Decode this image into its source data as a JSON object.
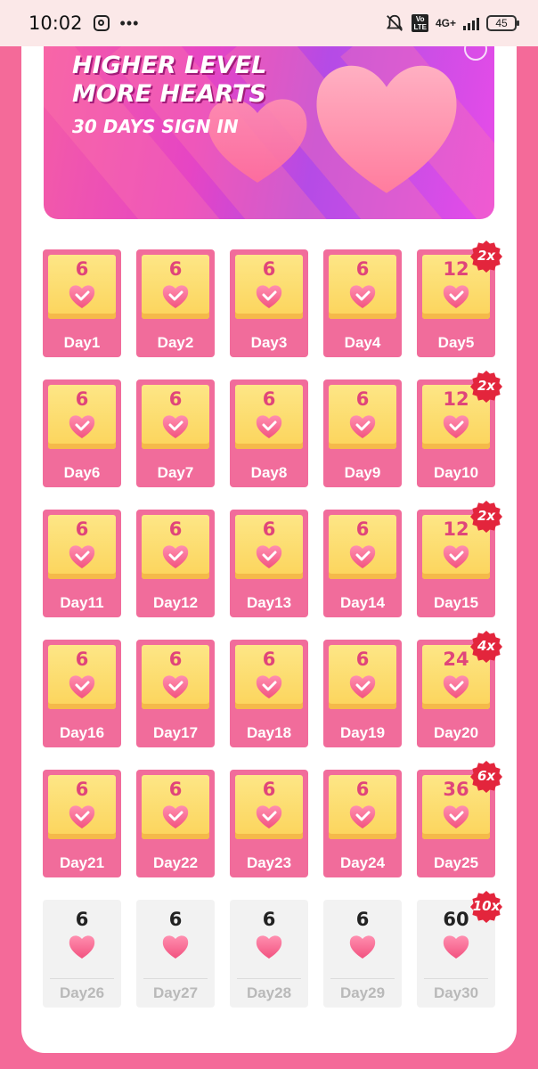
{
  "status_bar": {
    "time": "10:02",
    "network": "4G+",
    "volte": "Vo\nLTE",
    "battery": "45",
    "icons": [
      "instagram-icon",
      "more-dots-icon",
      "mute-icon",
      "volte-icon",
      "signal-icon",
      "battery-icon"
    ]
  },
  "banner": {
    "title_line1": "HIGHER LEVEL",
    "title_line2": "MORE HEARTS",
    "subtitle": "30 DAYS SIGN IN"
  },
  "colors": {
    "frame": "#f46a99",
    "tile_claimed": "#f16c9b",
    "tile_future": "#f2f2f2",
    "badge": "#e3253c",
    "amount_text": "#e0457a"
  },
  "days": [
    {
      "label": "Day1",
      "amount": "6",
      "status": "claimed",
      "badge": ""
    },
    {
      "label": "Day2",
      "amount": "6",
      "status": "claimed",
      "badge": ""
    },
    {
      "label": "Day3",
      "amount": "6",
      "status": "claimed",
      "badge": ""
    },
    {
      "label": "Day4",
      "amount": "6",
      "status": "claimed",
      "badge": ""
    },
    {
      "label": "Day5",
      "amount": "12",
      "status": "claimed",
      "badge": "2x"
    },
    {
      "label": "Day6",
      "amount": "6",
      "status": "claimed",
      "badge": ""
    },
    {
      "label": "Day7",
      "amount": "6",
      "status": "claimed",
      "badge": ""
    },
    {
      "label": "Day8",
      "amount": "6",
      "status": "claimed",
      "badge": ""
    },
    {
      "label": "Day9",
      "amount": "6",
      "status": "claimed",
      "badge": ""
    },
    {
      "label": "Day10",
      "amount": "12",
      "status": "claimed",
      "badge": "2x"
    },
    {
      "label": "Day11",
      "amount": "6",
      "status": "claimed",
      "badge": ""
    },
    {
      "label": "Day12",
      "amount": "6",
      "status": "claimed",
      "badge": ""
    },
    {
      "label": "Day13",
      "amount": "6",
      "status": "claimed",
      "badge": ""
    },
    {
      "label": "Day14",
      "amount": "6",
      "status": "claimed",
      "badge": ""
    },
    {
      "label": "Day15",
      "amount": "12",
      "status": "claimed",
      "badge": "2x"
    },
    {
      "label": "Day16",
      "amount": "6",
      "status": "claimed",
      "badge": ""
    },
    {
      "label": "Day17",
      "amount": "6",
      "status": "claimed",
      "badge": ""
    },
    {
      "label": "Day18",
      "amount": "6",
      "status": "claimed",
      "badge": ""
    },
    {
      "label": "Day19",
      "amount": "6",
      "status": "claimed",
      "badge": ""
    },
    {
      "label": "Day20",
      "amount": "24",
      "status": "claimed",
      "badge": "4x"
    },
    {
      "label": "Day21",
      "amount": "6",
      "status": "claimed",
      "badge": ""
    },
    {
      "label": "Day22",
      "amount": "6",
      "status": "claimed",
      "badge": ""
    },
    {
      "label": "Day23",
      "amount": "6",
      "status": "claimed",
      "badge": ""
    },
    {
      "label": "Day24",
      "amount": "6",
      "status": "claimed",
      "badge": ""
    },
    {
      "label": "Day25",
      "amount": "36",
      "status": "claimed",
      "badge": "6x"
    },
    {
      "label": "Day26",
      "amount": "6",
      "status": "future",
      "badge": ""
    },
    {
      "label": "Day27",
      "amount": "6",
      "status": "future",
      "badge": ""
    },
    {
      "label": "Day28",
      "amount": "6",
      "status": "future",
      "badge": ""
    },
    {
      "label": "Day29",
      "amount": "6",
      "status": "future",
      "badge": ""
    },
    {
      "label": "Day30",
      "amount": "60",
      "status": "future",
      "badge": "10x"
    }
  ]
}
